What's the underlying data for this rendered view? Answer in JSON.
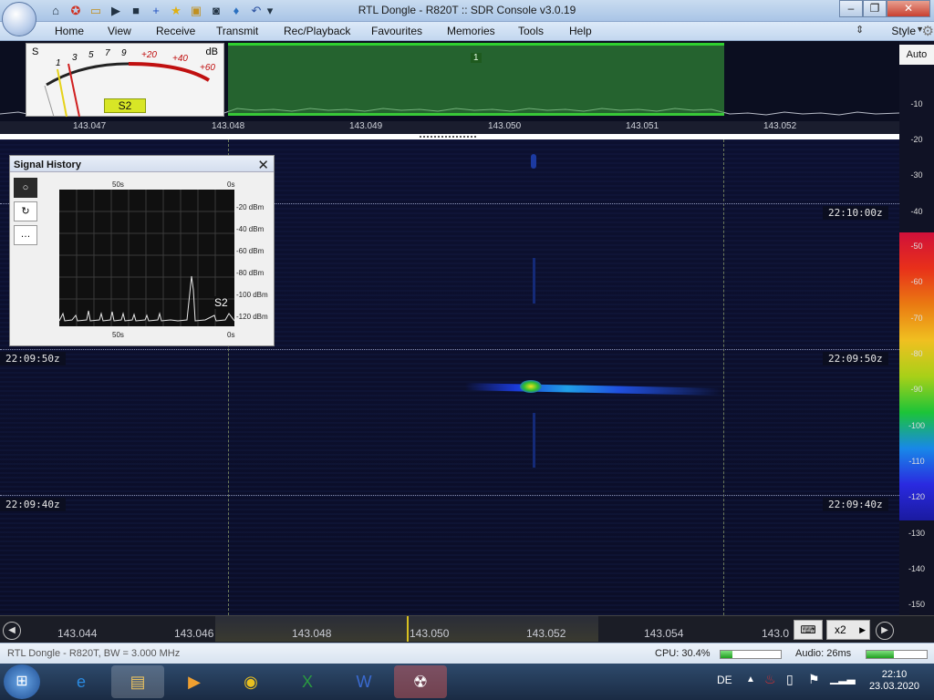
{
  "window": {
    "title": "RTL Dongle - R820T :: SDR Console v3.0.19",
    "minimize_label": "‒",
    "maximize_label": "❐",
    "close_label": "✕"
  },
  "menu": [
    "Home",
    "View",
    "Receive",
    "Transmit",
    "Rec/Playback",
    "Favourites",
    "Memories",
    "Tools",
    "Help"
  ],
  "style_label": "Style",
  "meter": {
    "s_label": "S",
    "db_label": "dB",
    "s_ticks": [
      "1",
      "3",
      "5",
      "7",
      "9"
    ],
    "plus_ticks": [
      "+20",
      "+40",
      "+60"
    ],
    "reading": "S2"
  },
  "passband_label": "1",
  "spectrum_freqs": [
    "143.047",
    "143.048",
    "143.049",
    "143.050",
    "143.051",
    "143.052"
  ],
  "timestamps": [
    "22:10:00z",
    "22:09:50z",
    "22:09:40z"
  ],
  "scale": {
    "auto_label": "Auto",
    "labels": [
      "-10",
      "-20",
      "-30",
      "-40",
      "-50",
      "-60",
      "-70",
      "-80",
      "-90",
      "-100",
      "-110",
      "-120",
      "-130",
      "-140",
      "-150"
    ],
    "colors": [
      "#d0103a",
      "#e8301a",
      "#ea7a12",
      "#f0c020",
      "#a8d018",
      "#1cc438",
      "#1888e8",
      "#2a2ae0",
      "#1a1aa0"
    ]
  },
  "signal_history": {
    "title": "Signal History",
    "close_label": "✕",
    "time_top_left": "50s",
    "time_top_right": "0s",
    "time_bottom_left": "50s",
    "time_bottom_right": "0s",
    "db_labels": [
      "-20 dBm",
      "-40 dBm",
      "-60 dBm",
      "-80 dBm",
      "-100 dBm",
      "-120 dBm"
    ],
    "reading": "S2"
  },
  "bottom_freqs": [
    "143.044",
    "143.046",
    "143.048",
    "143.050",
    "143.052",
    "143.054",
    "143.0"
  ],
  "zoom_label": "x2",
  "status": {
    "device": "RTL Dongle - R820T, BW = 3.000 MHz",
    "cpu": "CPU: 30.4%",
    "cpu_level": 0.2,
    "audio": "Audio: 26ms",
    "audio_level": 0.45
  },
  "taskbar": {
    "lang": "DE",
    "time": "22:10",
    "date": "23.03.2020"
  }
}
